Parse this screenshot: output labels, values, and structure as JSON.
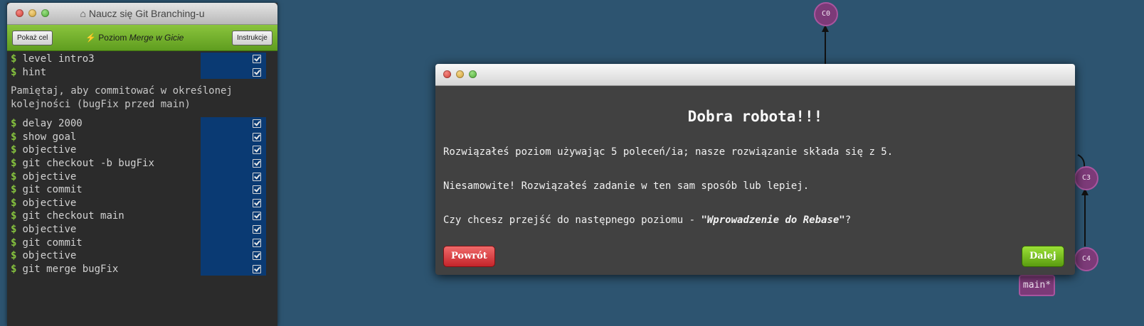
{
  "terminal": {
    "title": "Naucz się Git Branching-u",
    "show_goal_label": "Pokaż cel",
    "level_prefix": "Poziom",
    "level_name": "Merge w Gicie",
    "instructions_label": "Instrukcje",
    "prompt_symbol": "$",
    "commands_before_hint": [
      {
        "text": "level intro3"
      },
      {
        "text": "hint"
      }
    ],
    "hint_text": "Pamiętaj, aby commitować w określonej kolejności (bugFix przed main)",
    "commands_after_hint": [
      {
        "text": "delay 2000"
      },
      {
        "text": "show goal"
      },
      {
        "text": "objective"
      },
      {
        "text": "git checkout -b bugFix"
      },
      {
        "text": "objective"
      },
      {
        "text": "git commit"
      },
      {
        "text": "objective"
      },
      {
        "text": "git checkout main"
      },
      {
        "text": "objective"
      },
      {
        "text": "git commit"
      },
      {
        "text": "objective"
      },
      {
        "text": "git merge bugFix"
      }
    ]
  },
  "graph": {
    "nodes": [
      {
        "id": "C0",
        "label": "C0"
      },
      {
        "id": "C3",
        "label": "C3"
      },
      {
        "id": "C4",
        "label": "C4"
      }
    ],
    "branch": "main*"
  },
  "modal": {
    "heading": "Dobra robota!!!",
    "line1": "Rozwiązałeś poziom używając 5 poleceń/ia; nasze rozwiązanie składa się z 5.",
    "line2": "Niesamowite! Rozwiązałeś zadanie w ten sam sposób lub lepiej.",
    "line3_prefix": "Czy chcesz przejść do następnego poziomu - ",
    "line3_level": "\"Wprowadzenie do Rebase\"",
    "line3_suffix": "?",
    "back_label": "Powrót",
    "next_label": "Dalej"
  },
  "colors": {
    "background": "#2d5470",
    "node_fill": "#7c3a78",
    "toolbar_green": "#6fae2a",
    "back_button": "#d63a3a",
    "next_button": "#72b31f"
  }
}
